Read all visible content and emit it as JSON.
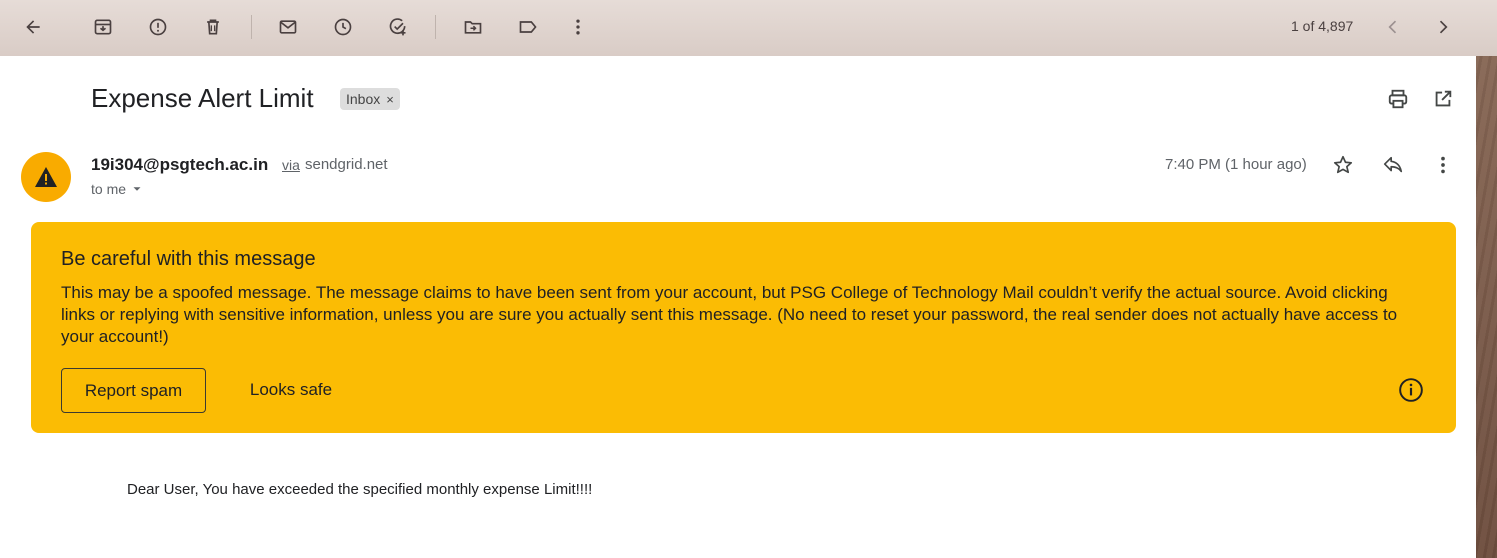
{
  "toolbar": {
    "icons": [
      "back-arrow-icon",
      "archive-icon",
      "report-spam-icon",
      "delete-icon",
      "mark-unread-icon",
      "snooze-icon",
      "add-task-icon",
      "move-to-icon",
      "label-icon",
      "more-vert-icon"
    ],
    "pager_text": "1 of 4,897"
  },
  "message": {
    "subject": "Expense Alert Limit",
    "label_chip": "Inbox",
    "label_chip_close": "×",
    "sender_email": "19i304@psgtech.ac.in",
    "via_text": "via",
    "via_domain": "sendgrid.net",
    "to_text": "to me",
    "time": "7:40 PM (1 hour ago)",
    "body": "Dear User, You have exceeded the specified monthly expense Limit!!!!"
  },
  "warning": {
    "title": "Be careful with this message",
    "text": "This may be a spoofed message. The message claims to have been sent from your account, but PSG College of Technology Mail couldn’t verify the actual source. Avoid clicking links or replying with sensitive information, unless you are sure you actually sent this message. (No need to reset your password, the real sender does not actually have access to your account!)",
    "report_spam_label": "Report spam",
    "looks_safe_label": "Looks safe",
    "background_color": "#fbbc04"
  },
  "colors": {
    "avatar_bg": "#f9ab00",
    "text_primary": "#202124",
    "text_secondary": "#5f6368"
  }
}
